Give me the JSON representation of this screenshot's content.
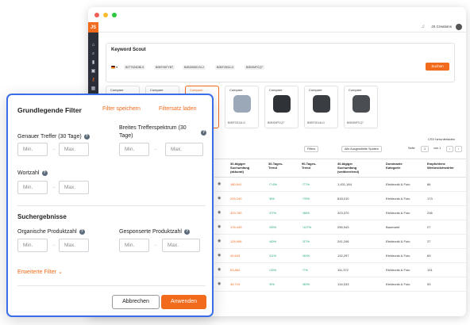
{
  "colors": {
    "accent": "#f26a1b",
    "dialog_border": "#3a6ee8",
    "positive": "#1aa36f",
    "sidebar": "#2b2f3a"
  },
  "app": {
    "logo": "JS",
    "account": "JS Creations",
    "sidebar_icons": [
      "home-icon",
      "search-icon",
      "chart-icon",
      "cube-icon",
      "key-icon",
      "grid-icon"
    ]
  },
  "scout": {
    "title": "Keyword Scout",
    "asins": [
      "B07T3Z6DBL9",
      "B0BF9DFYBT",
      "B0B2MBDVXL2",
      "B0BF2831LG",
      "B0BSNPCQ7"
    ],
    "search_label": "Suchen"
  },
  "compare": {
    "label": "Compare",
    "cards": [
      {
        "asin": ""
      },
      {
        "asin": ""
      },
      {
        "asin": ""
      },
      {
        "asin": "B0BF3G14LG"
      },
      {
        "asin": "B0BSNPCQ7"
      },
      {
        "asin": "B0BF3G14LG"
      },
      {
        "asin": "B0BSNPCQ7"
      }
    ]
  },
  "table": {
    "csv_label": "CSV herunterladen",
    "filter_label": "Filters",
    "variation_label": "Alle Ausgewählte Spalten",
    "page_label": "Seite",
    "page_value": "1",
    "page_of": "von 1",
    "headers": [
      "30-tägiger Suchumfang (akkurat)",
      "30-Tages-Trend",
      "90-Tages-Trend",
      "30-tägiger Suchumfang (weitbereiend)",
      "Dominante Kategorie",
      "Empfohlene Werbestichwörter"
    ],
    "rows": [
      {
        "sv": "180,541",
        "t30": "7.6%",
        "t90": "77%",
        "wide": "1,431,184",
        "cat": "Elektronik & Foto",
        "num": "66"
      },
      {
        "sv": "209,240",
        "t30": "8%",
        "t90": "75%",
        "wide": "818,010",
        "cat": "Elektronik & Foto",
        "num": "173"
      },
      {
        "sv": "329,789",
        "t30": "27%",
        "t90": "38%",
        "wide": "323,370",
        "cat": "Elektronik & Foto",
        "num": "236"
      },
      {
        "sv": "176,443",
        "t30": "33%",
        "t90": "127%",
        "wide": "256,943",
        "cat": "Baumarkt",
        "num": "27"
      },
      {
        "sv": "126,906",
        "t30": "40%",
        "t90": "37%",
        "wide": "241,246",
        "cat": "Elektronik & Foto",
        "num": "27"
      },
      {
        "sv": "40,643",
        "t30": "21%",
        "t90": "30%",
        "wide": "132,297",
        "cat": "Elektronik & Foto",
        "num": "69"
      },
      {
        "sv": "63,864",
        "t30": "13%",
        "t90": "7%",
        "wide": "111,372",
        "cat": "Elektronik & Foto",
        "num": "131"
      },
      {
        "sv": "45,719",
        "t30": "9%",
        "t90": "50%",
        "wide": "134,033",
        "cat": "Elektronik & Foto",
        "num": "53"
      }
    ]
  },
  "filter": {
    "title": "Grundlegende Filter",
    "save": "Filter speichern",
    "load": "Filtersatz laden",
    "exact": "Genauer Treffer (30 Tage)",
    "broad": "Breites Trefferspektrum (30 Tage)",
    "word_count": "Wortzahl",
    "results_section": "Suchergebnisse",
    "organic": "Organische Produktzahl",
    "sponsored": "Gesponserte Produktzahl",
    "min": "Min.",
    "max": "Max.",
    "advanced": "Erweiterte Filter",
    "cancel": "Abbrechen",
    "apply": "Anwenden"
  }
}
